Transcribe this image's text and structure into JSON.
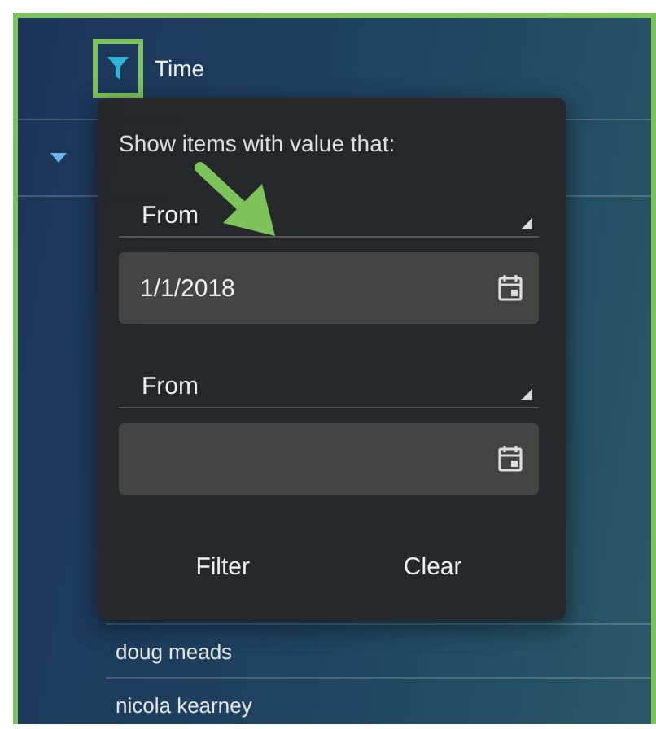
{
  "column": {
    "label": "Time",
    "filter_active": true
  },
  "group": {
    "expanded": true
  },
  "rows": [
    "doug meads",
    "nicola kearney"
  ],
  "filter_popup": {
    "prompt": "Show items with value that:",
    "conditions": [
      {
        "operator": "From",
        "value": "1/1/2018"
      },
      {
        "operator": "From"
      }
    ],
    "buttons": [
      "Filter",
      "Clear"
    ]
  }
}
